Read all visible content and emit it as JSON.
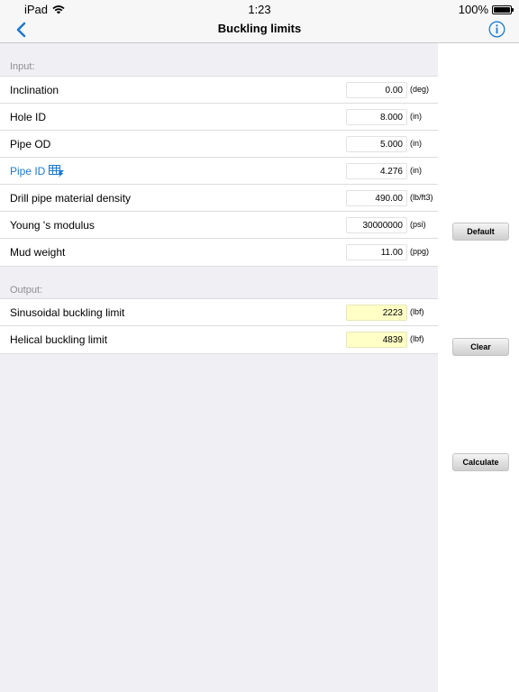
{
  "status": {
    "device": "iPad",
    "time": "1:23",
    "battery": "100%"
  },
  "nav": {
    "title": "Buckling limits"
  },
  "input": {
    "header": "Input:",
    "rows": [
      {
        "label": "Inclination",
        "value": "0.00",
        "unit": "(deg)"
      },
      {
        "label": "Hole ID",
        "value": "8.000",
        "unit": "(in)"
      },
      {
        "label": "Pipe OD",
        "value": "5.000",
        "unit": "(in)"
      },
      {
        "label": "Pipe ID",
        "value": "4.276",
        "unit": "(in)"
      },
      {
        "label": "Drill pipe material density",
        "value": "490.00",
        "unit": "(lb/ft3)"
      },
      {
        "label": "Young 's modulus",
        "value": "30000000",
        "unit": "(psi)"
      },
      {
        "label": "Mud weight",
        "value": "11.00",
        "unit": "(ppg)"
      }
    ]
  },
  "output": {
    "header": "Output:",
    "rows": [
      {
        "label": "Sinusoidal buckling limit",
        "value": "2223",
        "unit": "(lbf)"
      },
      {
        "label": "Helical buckling limit",
        "value": "4839",
        "unit": "(lbf)"
      }
    ]
  },
  "buttons": {
    "default": "Default",
    "clear": "Clear",
    "calculate": "Calculate"
  },
  "colors": {
    "accent": "#1b7ad0",
    "output_field": "#ffffc6",
    "background": "#efeff4"
  }
}
